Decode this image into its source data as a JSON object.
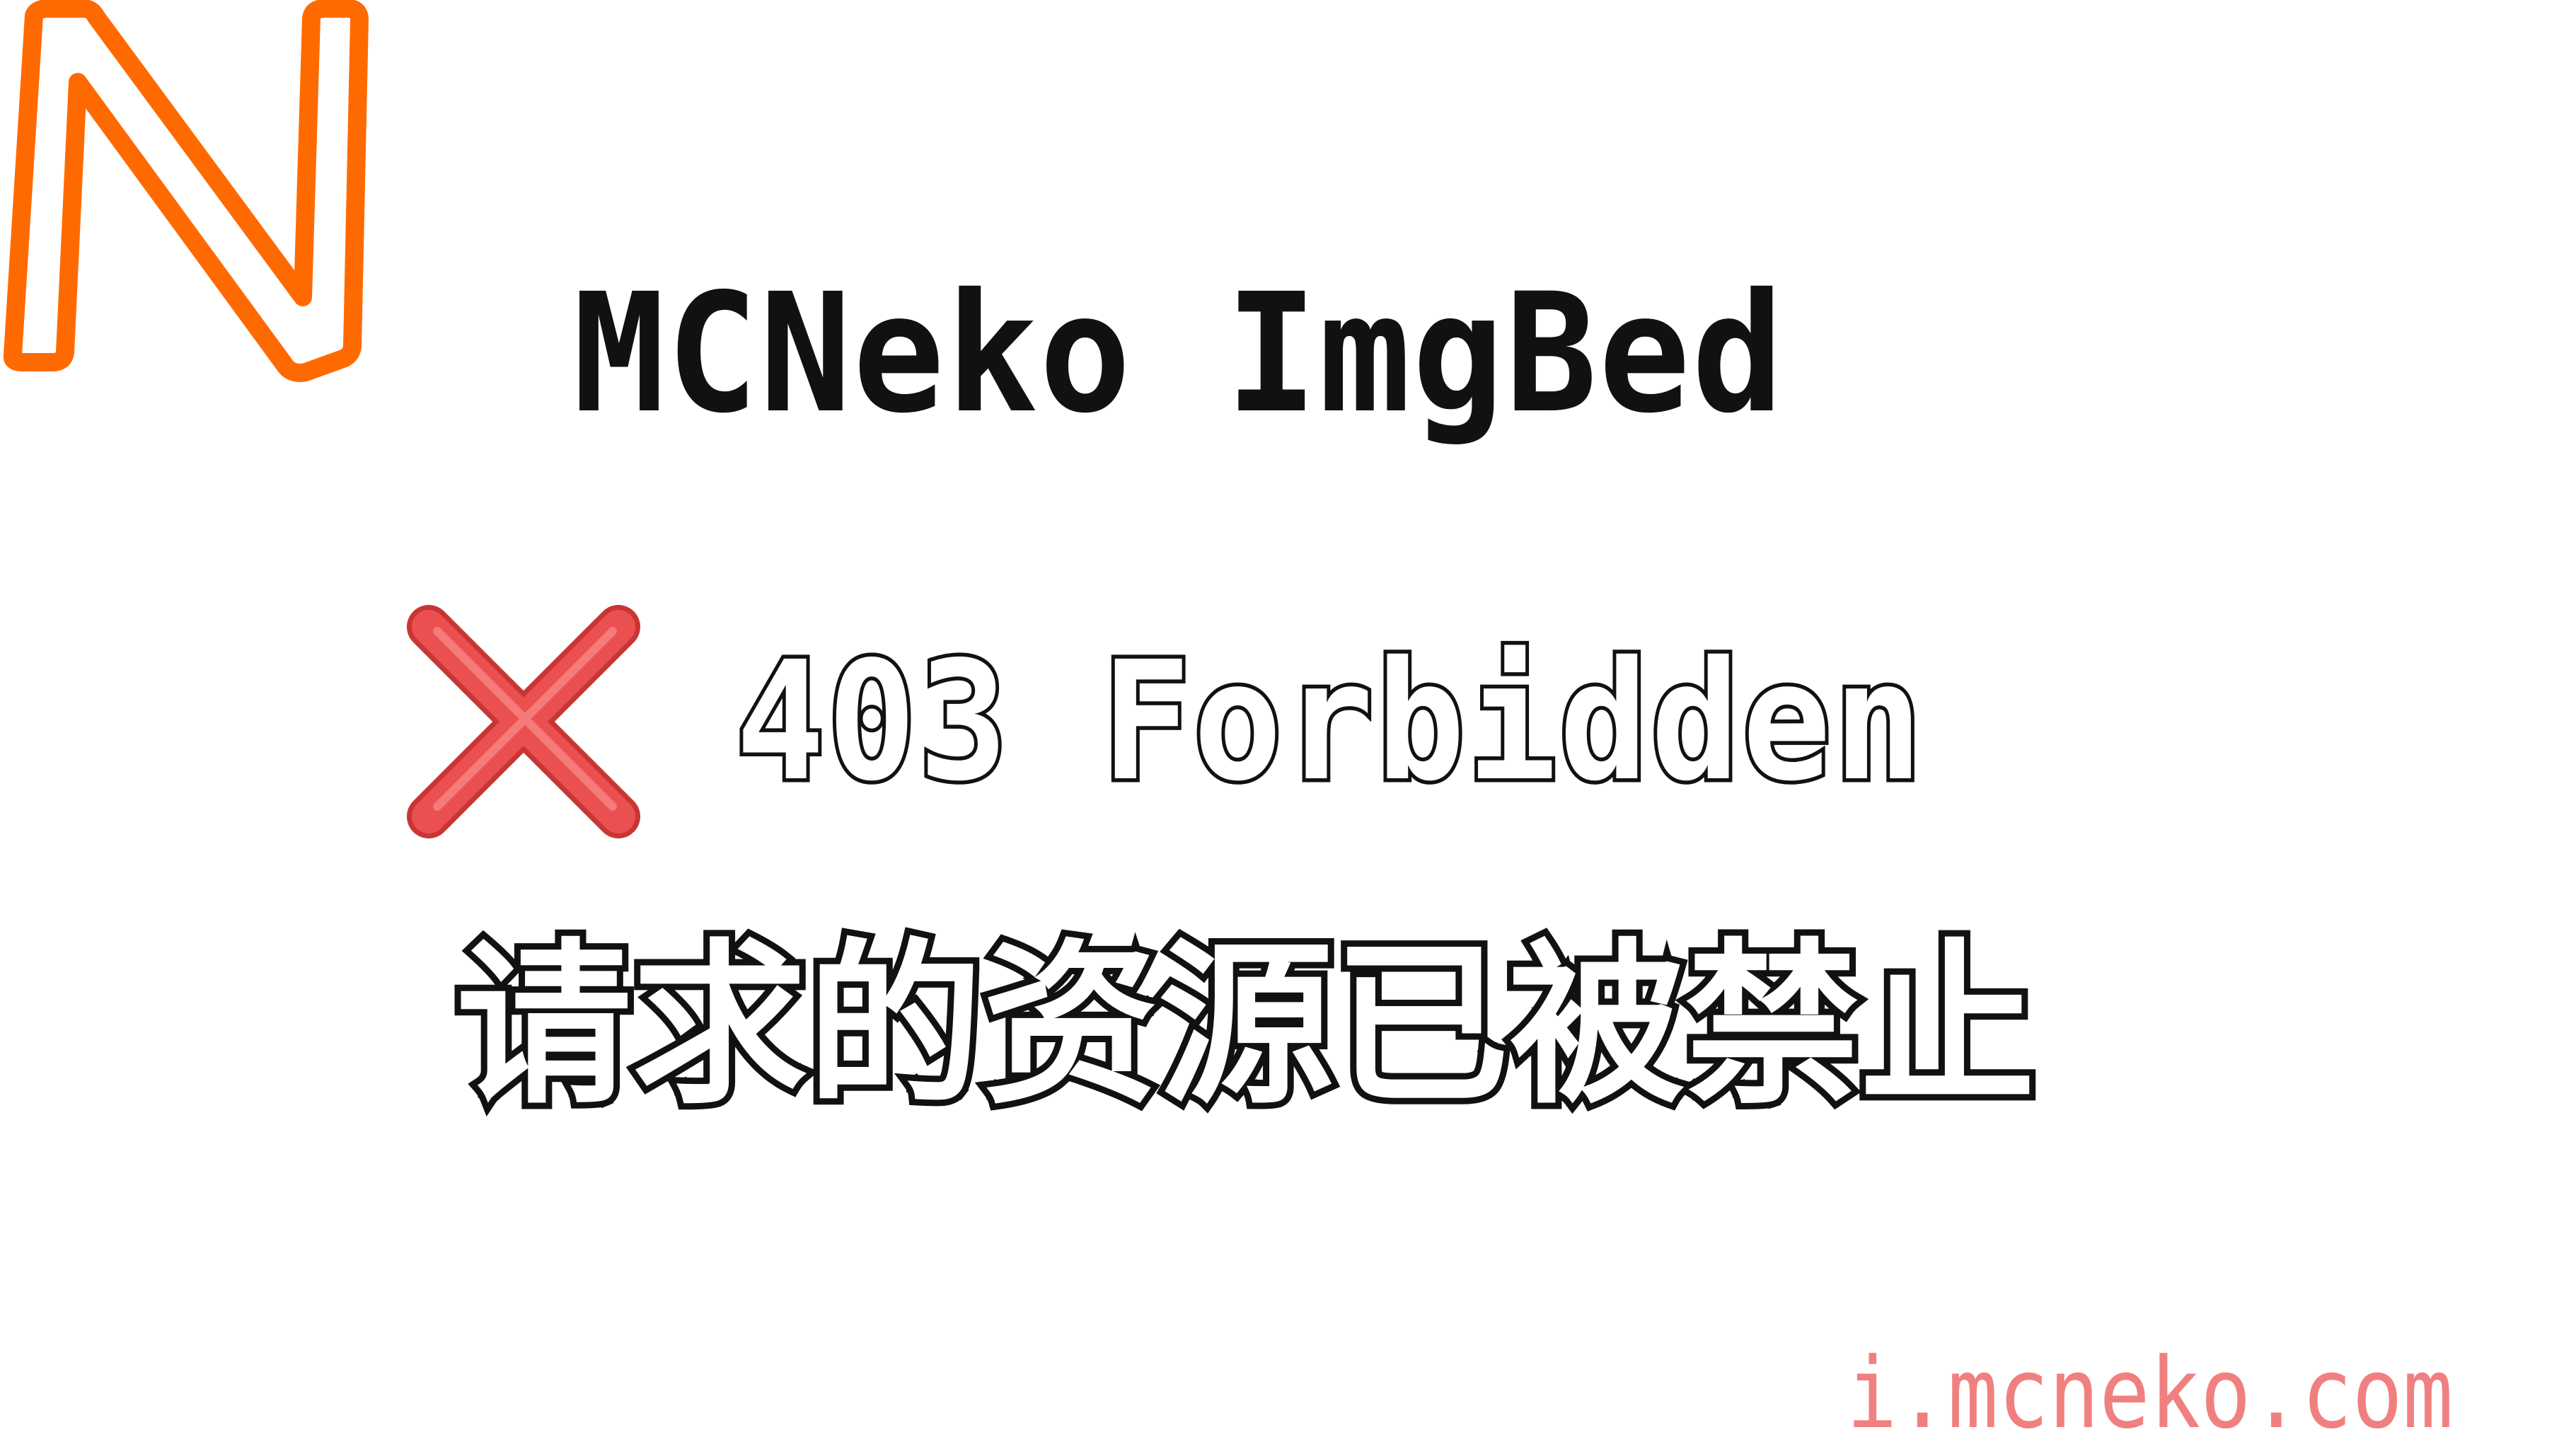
{
  "logo": {
    "letter": "N",
    "color": "#ff6a00"
  },
  "site_title": "MCNeko ImgBed",
  "error": {
    "icon": "cross-icon",
    "icon_color": "#e54848",
    "code": "403 Forbidden",
    "message": "请求的资源已被禁止"
  },
  "footer": {
    "url": "i.mcneko.com",
    "url_color": "#f08080"
  }
}
